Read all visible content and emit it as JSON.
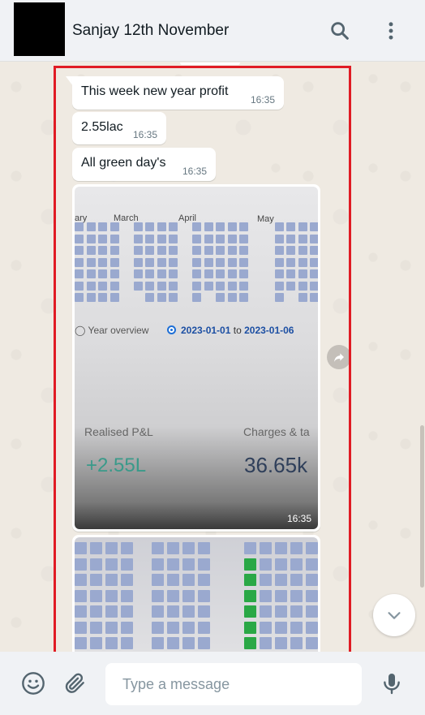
{
  "header": {
    "title": "Sanjay 12th November",
    "search_icon": "search-icon",
    "menu_icon": "more-vertical-icon"
  },
  "messages": [
    {
      "text": "This week new year profit",
      "time": "16:35"
    },
    {
      "text": "2.55lac",
      "time": "16:35"
    },
    {
      "text": "All green day's",
      "time": "16:35"
    }
  ],
  "image_message": {
    "time": "16:35",
    "months": [
      "ary",
      "March",
      "April",
      "May"
    ],
    "overview_label": "Year overview",
    "date_from": "2023-01-01",
    "date_to_word": "to",
    "date_to": "2023-01-06",
    "pl_label": "Realised P&L",
    "pl_value": "+2.55L",
    "charges_label": "Charges & ta",
    "charges_value": "36.65k"
  },
  "composer": {
    "placeholder": "Type a message",
    "emoji_icon": "emoji-icon",
    "attach_icon": "paperclip-icon",
    "mic_icon": "mic-icon"
  },
  "colors": {
    "header_bg": "#f0f2f5",
    "chat_bg": "#efeae2",
    "highlight": "#e01b24",
    "profit_green": "#3a9a8a",
    "heatmap_blue": "#9aa9cf",
    "heatmap_green": "#2aa846"
  }
}
